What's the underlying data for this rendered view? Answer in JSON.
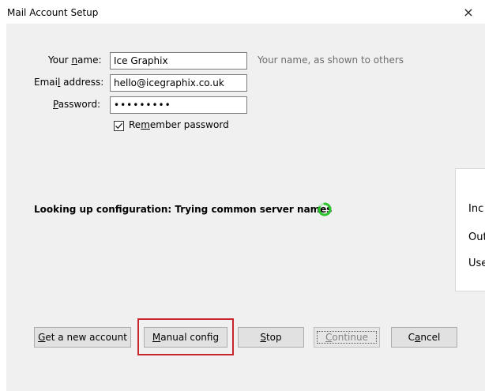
{
  "window": {
    "title": "Mail Account Setup",
    "close_glyph": "×"
  },
  "form": {
    "name_label_pre": "Your ",
    "name_label_key": "n",
    "name_label_post": "ame:",
    "name_value": "Ice Graphix",
    "name_hint": "Your name, as shown to others",
    "email_label_pre": "Emai",
    "email_label_key": "l",
    "email_label_post": " address:",
    "email_value": "hello@icegraphix.co.uk",
    "password_label_key": "P",
    "password_label_post": "assword:",
    "password_value": "•••••••••",
    "remember_pre": "Re",
    "remember_key": "m",
    "remember_post": "ember password",
    "remember_checked": true
  },
  "status": {
    "text": "Looking up configuration: Trying common server names",
    "spinner_icon": "loading-spinner-icon",
    "spinner_color": "#2ec42e"
  },
  "side_panel": {
    "labels": [
      "Inc",
      "Out",
      "Use"
    ]
  },
  "buttons": {
    "new_account_key": "G",
    "new_account_post": "et a new account",
    "manual_key": "M",
    "manual_post": "anual config",
    "stop_key": "S",
    "stop_post": "top",
    "continue_key": "C",
    "continue_post": "ontinue",
    "cancel_pre": "C",
    "cancel_key": "a",
    "cancel_post": "ncel",
    "continue_disabled": true
  },
  "annotation": {
    "highlight_color": "#c8242c"
  }
}
